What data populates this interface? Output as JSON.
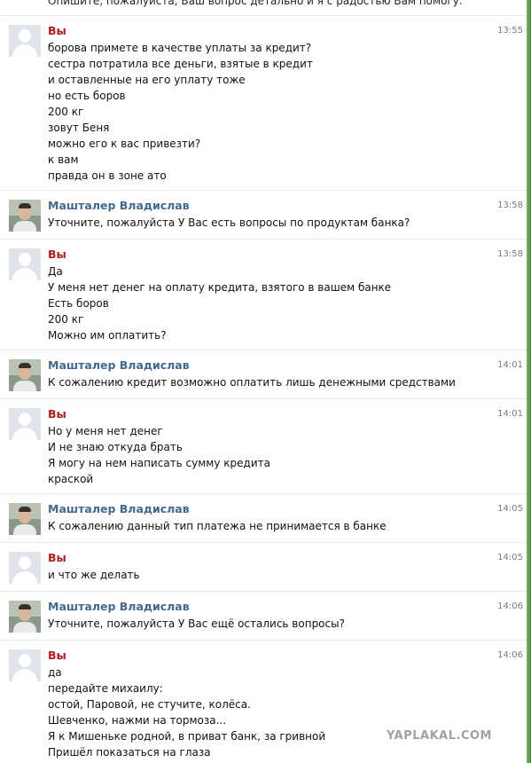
{
  "top_cut_text": "Опишите, пожалуйста, Ваш вопрос детально и я с радостью Вам помогу.",
  "messages": [
    {
      "sender": "self",
      "author": "Вы",
      "time": "13:55",
      "avatar_icon": "default-user-avatar-icon",
      "lines": [
        "борова примете в качестве уплаты за кредит?",
        "сестра потратила все деньги, взятые в кредит",
        "и оставленные на его уплату тоже",
        "но есть боров",
        "200 кг",
        "зовут Беня",
        "можно его к вас привезти?",
        "к вам",
        "правда он в зоне ато"
      ]
    },
    {
      "sender": "agent",
      "author": "Мaштaлер Владислав",
      "time": "13:58",
      "avatar_icon": "agent-photo-avatar-icon",
      "lines": [
        "Уточните, пожалуйста У Вас есть вопросы по продуктам банка?"
      ]
    },
    {
      "sender": "self",
      "author": "Вы",
      "time": "13:58",
      "avatar_icon": "default-user-avatar-icon",
      "lines": [
        "Да",
        "У меня нет денег на оплату кредита, взятого в вашем банке",
        "Есть боров",
        "200 кг",
        "Можно им оплатить?"
      ]
    },
    {
      "sender": "agent",
      "author": "Мaштaлер Владислав",
      "time": "14:01",
      "avatar_icon": "agent-photo-avatar-icon",
      "lines": [
        "К сожалению кредит возможно оплатить лишь денежными средствами"
      ]
    },
    {
      "sender": "self",
      "author": "Вы",
      "time": "14:01",
      "avatar_icon": "default-user-avatar-icon",
      "lines": [
        "Но у меня нет денег",
        "И не знаю откуда брать",
        "Я могу на нем написать сумму кредита",
        "краской"
      ]
    },
    {
      "sender": "agent",
      "author": "Мaштaлер Владислав",
      "time": "14:05",
      "avatar_icon": "agent-photo-avatar-icon",
      "lines": [
        "К сожалению данный тип платежа не принимается в банке"
      ]
    },
    {
      "sender": "self",
      "author": "Вы",
      "time": "14:05",
      "avatar_icon": "default-user-avatar-icon",
      "lines": [
        "и что же делать"
      ]
    },
    {
      "sender": "agent",
      "author": "Мaштaлер Владислав",
      "time": "14:06",
      "avatar_icon": "agent-photo-avatar-icon",
      "lines": [
        "Уточните, пожалуйста У Вас ещё остались вопросы?"
      ]
    },
    {
      "sender": "self",
      "author": "Вы",
      "time": "14:06",
      "avatar_icon": "default-user-avatar-icon",
      "lines": [
        "да",
        "передайте михаилу:",
        "остой, Паровой, не стучите, колёса.",
        "Шевченко, нажми на тормоза...",
        "Я к Мишеньке родной, в приват банк, за гривной",
        "Пришёл показаться на глаза"
      ]
    }
  ],
  "watermark": "YAPLAKAL.COM",
  "colors": {
    "self_name": "#ad1e1e",
    "agent_name": "#45688e",
    "divider": "#e3e8ee"
  }
}
